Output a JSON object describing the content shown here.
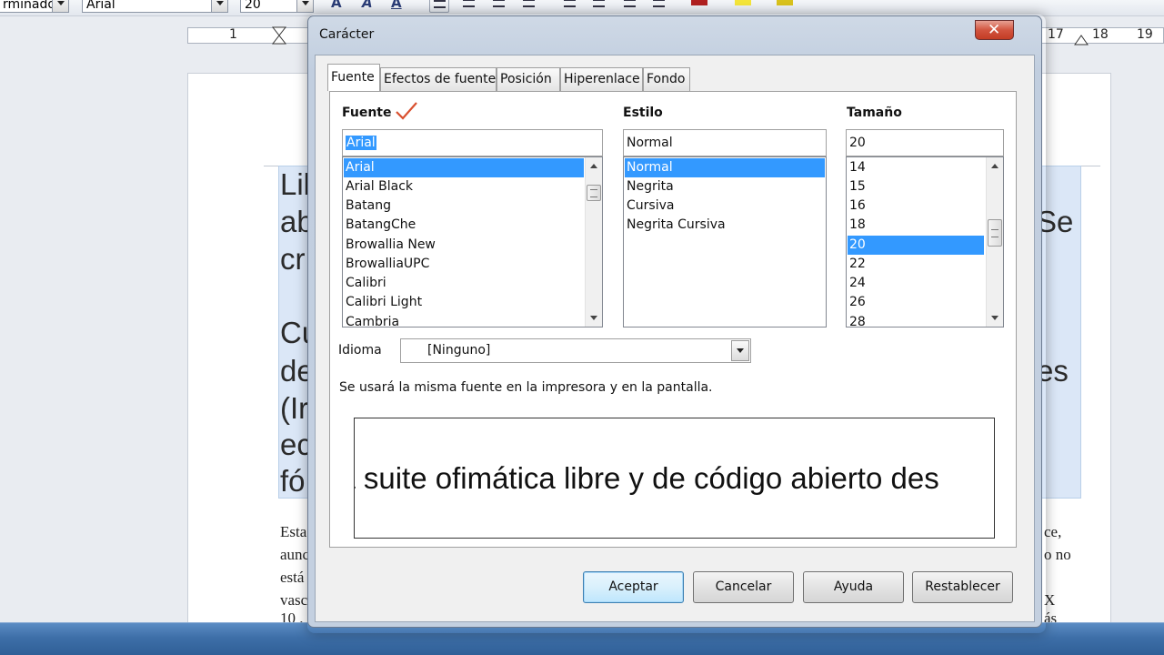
{
  "toolbar": {
    "style_value": "rminado",
    "font_value": "Arial",
    "size_value": "20"
  },
  "ruler": {
    "left_num": "1",
    "right_nums": [
      "17",
      "18",
      "19"
    ]
  },
  "document": {
    "big_fragments": [
      "Lil",
      "ab",
      "cr",
      "Cu",
      "de",
      "(Ir",
      "ec",
      "fó",
      "Se",
      "es"
    ],
    "small_fragments": [
      "Esta",
      "aunc",
      "está",
      "vasc",
      "10 .",
      "ce,",
      "o no",
      "X",
      "ás"
    ]
  },
  "dialog": {
    "title": "Carácter",
    "close_symbol": "✕",
    "tabs": [
      "Fuente",
      "Efectos de fuente",
      "Posición",
      "Hiperenlace",
      "Fondo"
    ],
    "active_tab": "Fuente",
    "font_label": "Fuente",
    "style_label": "Estilo",
    "size_label": "Tamaño",
    "font_input": "Arial",
    "style_input": "Normal",
    "size_input": "20",
    "font_list": [
      "Arial",
      "Arial Black",
      "Batang",
      "BatangChe",
      "Browallia New",
      "BrowalliaUPC",
      "Calibri",
      "Calibri Light",
      "Cambria"
    ],
    "font_selected_index": 0,
    "style_list": [
      "Normal",
      "Negrita",
      "Cursiva",
      "Negrita Cursiva"
    ],
    "style_selected_index": 0,
    "size_list": [
      "14",
      "15",
      "16",
      "18",
      "20",
      "22",
      "24",
      "26",
      "28"
    ],
    "size_selected_index": 4,
    "language_label": "Idioma",
    "language_value": "[Ninguno]",
    "info_text": "Se usará la misma fuente en la impresora y en la pantalla.",
    "preview_text": "la suite ofimática libre y de código abierto des",
    "buttons": {
      "ok": "Aceptar",
      "cancel": "Cancelar",
      "help": "Ayuda",
      "reset": "Restablecer"
    },
    "accent_color": "#3399ff",
    "check_color": "#d9502f"
  }
}
